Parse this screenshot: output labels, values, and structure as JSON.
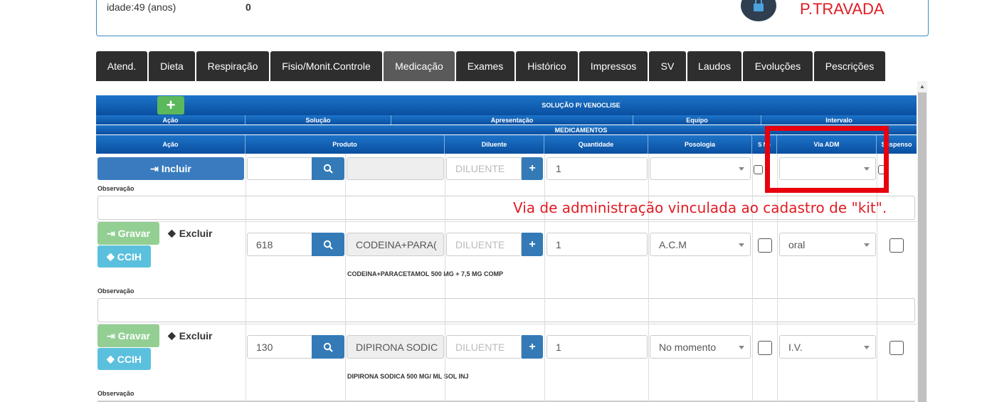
{
  "patient": {
    "age_label": "idade:49 (anos)",
    "value": "0",
    "lock_status": "P.TRAVADA"
  },
  "tabs": [
    {
      "label": "Atend."
    },
    {
      "label": "Dieta"
    },
    {
      "label": "Respiração"
    },
    {
      "label": "Fisio/Monit.Controle"
    },
    {
      "label": "Medicação"
    },
    {
      "label": "Exames"
    },
    {
      "label": "Histórico"
    },
    {
      "label": "Impressos"
    },
    {
      "label": "SV"
    },
    {
      "label": "Laudos"
    },
    {
      "label": "Evoluções"
    },
    {
      "label": "Pescrições"
    }
  ],
  "venoclise": {
    "title": "SOLUÇÃO P/ VENOCLISE",
    "acao": "Ação",
    "solucao": "Solução",
    "apresentacao": "Apresentação",
    "equipo": "Equipo",
    "intervalo": "Intervalo"
  },
  "medicamentos": {
    "title": "MEDICAMENTOS",
    "headers": {
      "acao": "Ação",
      "produto": "Produto",
      "diluente": "Diluente",
      "quantidade": "Quantidade",
      "posologia": "Posologia",
      "se_necessario": "S Ne",
      "via_adm": "Via ADM",
      "suspenso": "Suspenso"
    },
    "new_row": {
      "include_label": "Incluir",
      "diluente_placeholder": "DILUENTE",
      "quantidade": "1",
      "plus": "+"
    },
    "observacao_label": "Observação",
    "rows": [
      {
        "gravar": "Gravar",
        "excluir": "Excluir",
        "ccih": "CCIH",
        "code": "618",
        "produto": "CODEINA+PARA(",
        "diluente_placeholder": "DILUENTE",
        "quantidade": "1",
        "posologia": "A.C.M",
        "via": "oral",
        "description": "CODEINA+PARACETAMOL 500 MG + 7,5 MG COMP"
      },
      {
        "gravar": "Gravar",
        "excluir": "Excluir",
        "ccih": "CCIH",
        "code": "130",
        "produto": "DIPIRONA SODIC",
        "diluente_placeholder": "DILUENTE",
        "quantidade": "1",
        "posologia": "No momento",
        "via": "I.V.",
        "description": "DIPIRONA SODICA 500 MG/ ML SOL INJ"
      }
    ]
  },
  "annotation": {
    "text": "Via de administração vinculada ao cadastro de \"kit\"."
  },
  "colors": {
    "accent_blue": "#0a4fa0",
    "tab_dark": "#2e2e2e",
    "annotation_red": "#e8000d",
    "green_button": "#93cf93",
    "cyan_button": "#5bc0de"
  }
}
